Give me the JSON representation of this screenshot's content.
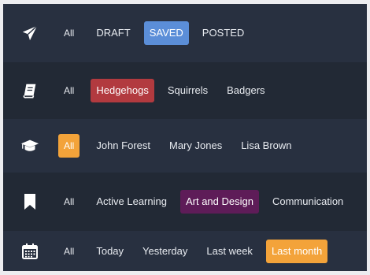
{
  "rows": [
    {
      "icon": "paper-plane-icon",
      "all_label": "All",
      "options": [
        "DRAFT",
        "SAVED",
        "POSTED"
      ],
      "selected": "SAVED",
      "selected_color": "#5b8ed8"
    },
    {
      "icon": "notebook-icon",
      "all_label": "All",
      "options": [
        "Hedgehogs",
        "Squirrels",
        "Badgers"
      ],
      "selected": "Hedgehogs",
      "selected_color": "#b23a3f"
    },
    {
      "icon": "graduation-cap-icon",
      "all_label": "All",
      "options": [
        "John Forest",
        "Mary Jones",
        "Lisa Brown"
      ],
      "selected": "All",
      "selected_color": "#f3a33a"
    },
    {
      "icon": "bookmark-icon",
      "all_label": "All",
      "options": [
        "Active Learning",
        "Art and Design",
        "Communication"
      ],
      "selected": "Art and Design",
      "selected_color": "#5e1c58"
    },
    {
      "icon": "calendar-icon",
      "all_label": "All",
      "options": [
        "Today",
        "Yesterday",
        "Last week",
        "Last month"
      ],
      "selected": "Last month",
      "selected_color": "#f3a33a"
    }
  ]
}
